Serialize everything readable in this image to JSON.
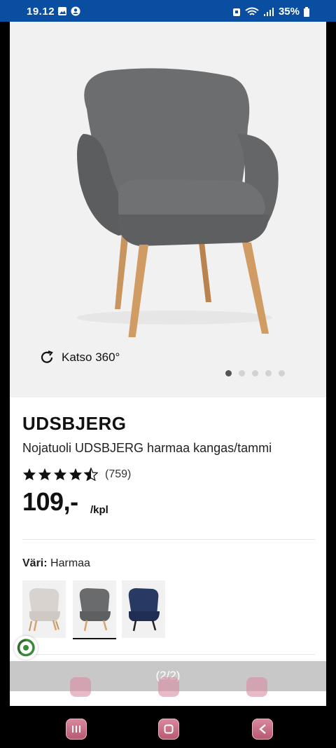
{
  "status_bar": {
    "time": "19.12",
    "battery": "35%",
    "icons": [
      "gallery-icon",
      "account-icon",
      "alarm-icon",
      "wifi-icon",
      "signal-icon",
      "battery-icon"
    ]
  },
  "gallery": {
    "view360_label": "Katso 360°",
    "dots_total": 5,
    "dots_active": 1
  },
  "product": {
    "name": "UDSBJERG",
    "description": "Nojatuoli UDSBJERG harmaa kangas/tammi",
    "rating_stars": 4.5,
    "rating_count": "(759)",
    "price": "109,-",
    "unit": "/kpl"
  },
  "color": {
    "label": "Väri:",
    "value": "Harmaa",
    "swatches": [
      "beige",
      "grey",
      "navy"
    ],
    "selected": "grey"
  },
  "overlay": {
    "pager": "(2/2)"
  },
  "colors": {
    "status_bar_bg": "#0a4ea1",
    "gallery_bg": "#f1f1f1",
    "nav_button": "#c76d85"
  }
}
